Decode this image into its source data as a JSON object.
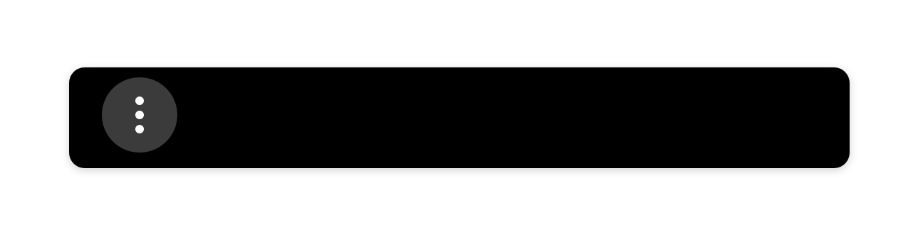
{
  "toolbar": {
    "background_color": "#000000",
    "more_button": {
      "icon": "more-vertical-icon",
      "background_color": "#3b3b3b",
      "icon_color": "#ffffff"
    }
  }
}
